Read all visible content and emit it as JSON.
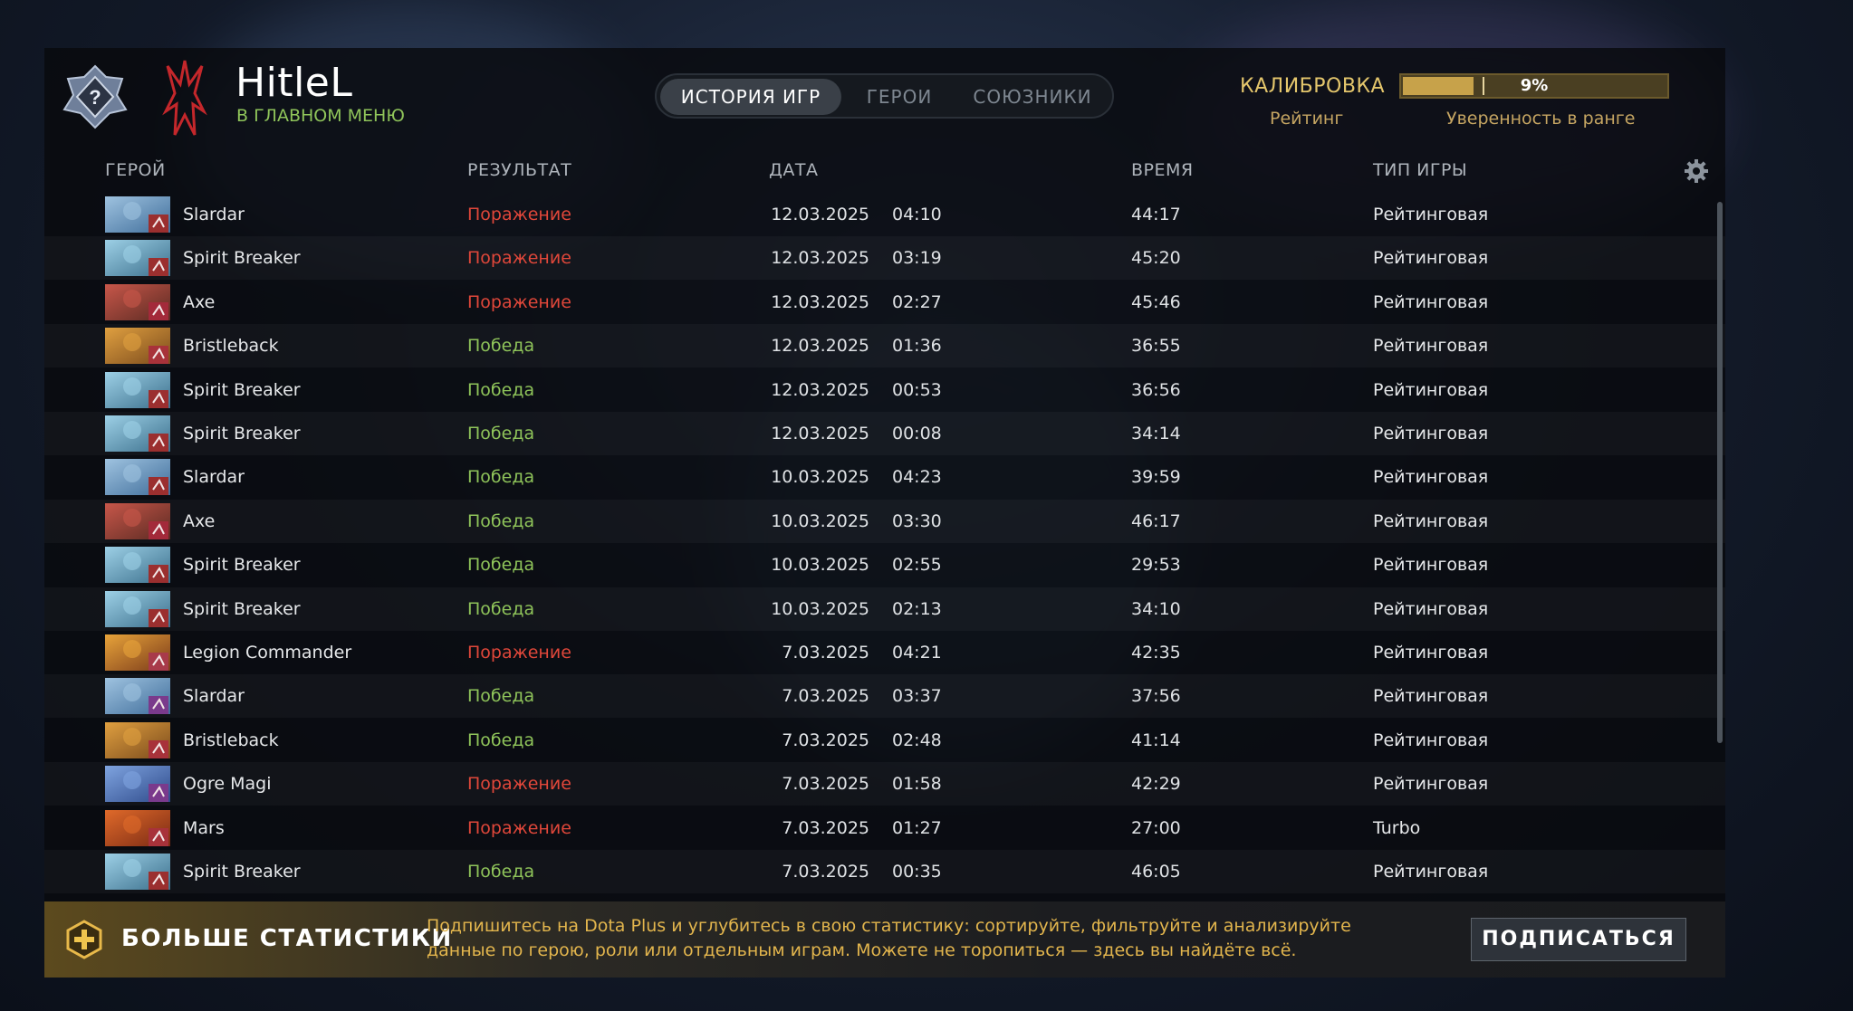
{
  "player": {
    "name": "HitleL",
    "status": "В ГЛАВНОМ МЕНЮ",
    "rank_badge_icon": "unknown-rank-question-icon",
    "hero_emblem_icon": "red-claw-emblem-icon"
  },
  "tabs": [
    {
      "label": "ИСТОРИЯ ИГР",
      "active": true
    },
    {
      "label": "ГЕРОИ",
      "active": false
    },
    {
      "label": "СОЮЗНИКИ",
      "active": false
    }
  ],
  "calibration": {
    "title": "КАЛИБРОВКА",
    "rating_label": "Рейтинг",
    "confidence_value": "9%",
    "confidence_fraction": 0.09,
    "confidence_label": "Уверенность в ранге"
  },
  "columns": {
    "hero": "ГЕРОЙ",
    "result": "РЕЗУЛЬТАТ",
    "date": "ДАТА",
    "duration": "ВРЕМЯ",
    "game_type": "ТИП ИГРЫ",
    "settings_icon": "gear-icon"
  },
  "colors": {
    "win": "#8fc45a",
    "loss": "#e0473a",
    "accent_gold": "#e4c66c"
  },
  "matches": [
    {
      "hero": "Slardar",
      "result": "Поражение",
      "outcome": "loss",
      "date": "12.03.2025",
      "time": "04:10",
      "duration": "44:17",
      "type": "Рейтинговая",
      "role_icon": "offlane-role-icon"
    },
    {
      "hero": "Spirit Breaker",
      "result": "Поражение",
      "outcome": "loss",
      "date": "12.03.2025",
      "time": "03:19",
      "duration": "45:20",
      "type": "Рейтинговая",
      "role_icon": "offlane-role-icon"
    },
    {
      "hero": "Axe",
      "result": "Поражение",
      "outcome": "loss",
      "date": "12.03.2025",
      "time": "02:27",
      "duration": "45:46",
      "type": "Рейтинговая",
      "role_icon": "initiator-role-icon"
    },
    {
      "hero": "Bristleback",
      "result": "Победа",
      "outcome": "win",
      "date": "12.03.2025",
      "time": "01:36",
      "duration": "36:55",
      "type": "Рейтинговая",
      "role_icon": "durable-role-icon"
    },
    {
      "hero": "Spirit Breaker",
      "result": "Победа",
      "outcome": "win",
      "date": "12.03.2025",
      "time": "00:53",
      "duration": "36:56",
      "type": "Рейтинговая",
      "role_icon": "offlane-role-icon"
    },
    {
      "hero": "Spirit Breaker",
      "result": "Победа",
      "outcome": "win",
      "date": "12.03.2025",
      "time": "00:08",
      "duration": "34:14",
      "type": "Рейтинговая",
      "role_icon": "offlane-role-icon"
    },
    {
      "hero": "Slardar",
      "result": "Победа",
      "outcome": "win",
      "date": "10.03.2025",
      "time": "04:23",
      "duration": "39:59",
      "type": "Рейтинговая",
      "role_icon": "offlane-role-icon"
    },
    {
      "hero": "Axe",
      "result": "Победа",
      "outcome": "win",
      "date": "10.03.2025",
      "time": "03:30",
      "duration": "46:17",
      "type": "Рейтинговая",
      "role_icon": "initiator-role-icon"
    },
    {
      "hero": "Spirit Breaker",
      "result": "Победа",
      "outcome": "win",
      "date": "10.03.2025",
      "time": "02:55",
      "duration": "29:53",
      "type": "Рейтинговая",
      "role_icon": "offlane-role-icon"
    },
    {
      "hero": "Spirit Breaker",
      "result": "Победа",
      "outcome": "win",
      "date": "10.03.2025",
      "time": "02:13",
      "duration": "34:10",
      "type": "Рейтинговая",
      "role_icon": "offlane-role-icon"
    },
    {
      "hero": "Legion Commander",
      "result": "Поражение",
      "outcome": "loss",
      "date": "7.03.2025",
      "time": "04:21",
      "duration": "42:35",
      "type": "Рейтинговая",
      "role_icon": "carry-role-icon"
    },
    {
      "hero": "Slardar",
      "result": "Победа",
      "outcome": "win",
      "date": "7.03.2025",
      "time": "03:37",
      "duration": "37:56",
      "type": "Рейтинговая",
      "role_icon": "support-role-icon"
    },
    {
      "hero": "Bristleback",
      "result": "Победа",
      "outcome": "win",
      "date": "7.03.2025",
      "time": "02:48",
      "duration": "41:14",
      "type": "Рейтинговая",
      "role_icon": "durable-role-icon"
    },
    {
      "hero": "Ogre Magi",
      "result": "Поражение",
      "outcome": "loss",
      "date": "7.03.2025",
      "time": "01:58",
      "duration": "42:29",
      "type": "Рейтинговая",
      "role_icon": "support-role-icon"
    },
    {
      "hero": "Mars",
      "result": "Поражение",
      "outcome": "loss",
      "date": "7.03.2025",
      "time": "01:27",
      "duration": "27:00",
      "type": "Turbo",
      "role_icon": "durable-role-icon"
    },
    {
      "hero": "Spirit Breaker",
      "result": "Победа",
      "outcome": "win",
      "date": "7.03.2025",
      "time": "00:35",
      "duration": "46:05",
      "type": "Рейтинговая",
      "role_icon": "offlane-role-icon"
    }
  ],
  "banner": {
    "icon": "dota-plus-icon",
    "title": "БОЛЬШЕ СТАТИСТИКИ",
    "text": "Подпишитесь на Dota Plus и углубитесь в свою статистику: сортируйте, фильтруйте и анализируйте данные по герою, роли или отдельным играм. Можете не торопиться — здесь вы найдёте всё.",
    "button_label": "ПОДПИСАТЬСЯ"
  }
}
